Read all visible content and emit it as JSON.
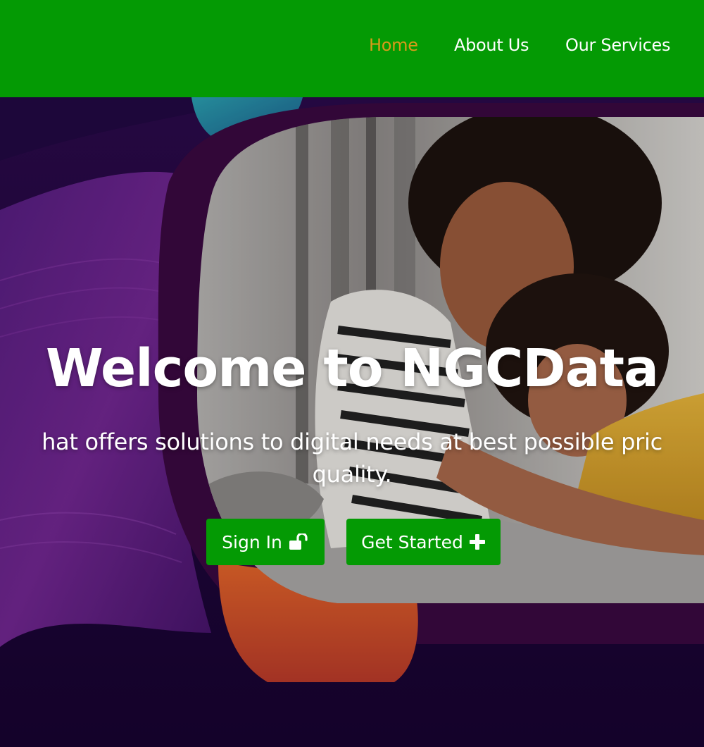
{
  "nav": {
    "items": [
      {
        "label": "Home",
        "active": true
      },
      {
        "label": "About Us",
        "active": false
      },
      {
        "label": "Our Services",
        "active": false
      }
    ],
    "background_color": "#049a04",
    "active_color": "#d99a1a"
  },
  "hero": {
    "title": "Welcome to NGCData",
    "subtitle_line1": "hat offers solutions to digital needs at best possible pric",
    "subtitle_line2": "quality.",
    "buttons": [
      {
        "label": "Sign In",
        "icon": "unlock-icon"
      },
      {
        "label": "Get Started",
        "icon": "plus-icon"
      }
    ]
  }
}
